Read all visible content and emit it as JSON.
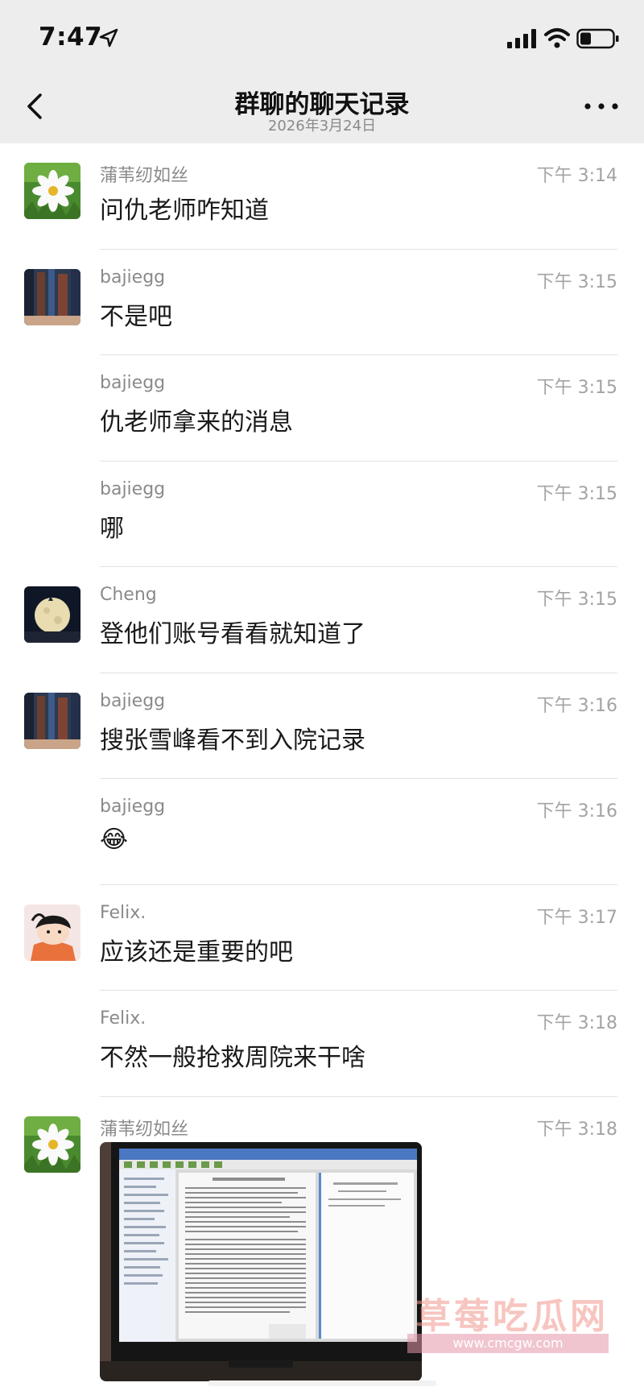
{
  "status": {
    "time": "7:47"
  },
  "header": {
    "title": "群聊的聊天记录",
    "subtitle": "2026年3月24日"
  },
  "messages": [
    {
      "sender": "蒲苇纫如丝",
      "time": "下午 3:14",
      "text": "问仇老师咋知道",
      "avatar": "cosmos-flower"
    },
    {
      "sender": "bajiegg",
      "time": "下午 3:15",
      "text": "不是吧",
      "avatar": "building-photo"
    },
    {
      "sender": "bajiegg",
      "time": "下午 3:15",
      "text": "仇老师拿来的消息",
      "avatar": ""
    },
    {
      "sender": "bajiegg",
      "time": "下午 3:15",
      "text": "哪",
      "avatar": ""
    },
    {
      "sender": "Cheng",
      "time": "下午 3:15",
      "text": "登他们账号看看就知道了",
      "avatar": "moon-photo"
    },
    {
      "sender": "bajiegg",
      "time": "下午 3:16",
      "text": "搜张雪峰看不到入院记录",
      "avatar": "building-photo"
    },
    {
      "sender": "bajiegg",
      "time": "下午 3:16",
      "text": "😂",
      "avatar": ""
    },
    {
      "sender": "Felix.",
      "time": "下午 3:17",
      "text": "应该还是重要的吧",
      "avatar": "cartoon-character"
    },
    {
      "sender": "Felix.",
      "time": "下午 3:18",
      "text": "不然一般抢救周院来干啥",
      "avatar": ""
    }
  ],
  "image_message": {
    "sender": "蒲苇纫如丝",
    "time": "下午 3:18",
    "avatar": "cosmos-flower",
    "content": "photo-of-monitor-screen"
  },
  "watermark": {
    "title": "草莓吃瓜网",
    "url": "www.cmcgw.com"
  },
  "colors": {
    "nav_bg": "#ededed",
    "divider": "#e2e2e2",
    "meta_text": "#8a8a8a"
  }
}
